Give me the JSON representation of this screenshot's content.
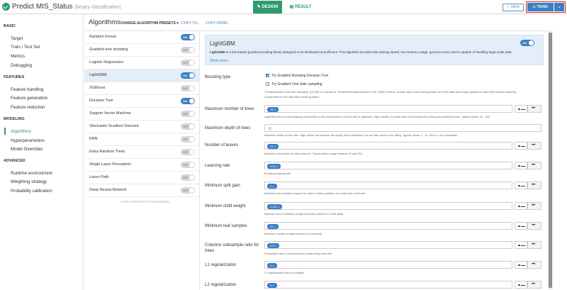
{
  "header": {
    "title": "Predict MIS_Status",
    "subtitle": "(binary classification)",
    "tab_design": "DESIGN",
    "tab_result": "RESULT",
    "save_label": "SAVE",
    "train_label": "TRAIN"
  },
  "sidebar": {
    "sections": [
      {
        "title": "BASIC",
        "items": [
          "Target",
          "Train / Test Set",
          "Metrics",
          "Debugging"
        ]
      },
      {
        "title": "FEATURES",
        "items": [
          "Feature handling",
          "Feature generation",
          "Feature reduction"
        ]
      },
      {
        "title": "MODELING",
        "items": [
          "Algorithms",
          "Hyperparameters",
          "Model Overrides"
        ]
      },
      {
        "title": "ADVANCED",
        "items": [
          "Runtime environment",
          "Weighting strategy",
          "Probability calibration"
        ]
      }
    ],
    "active": "Algorithms"
  },
  "algorithms_panel": {
    "title": "Algorithms",
    "presets_label": "CHANGE ALGORITHM PRESETS",
    "copy_to": "COPY TO...",
    "copy_from": "COPY FROM...",
    "add_custom": "ADD CUSTOM PYTHON MODEL"
  },
  "algorithms": [
    {
      "name": "Random Forest",
      "state": "ON"
    },
    {
      "name": "Gradient tree boosting",
      "state": "OFF"
    },
    {
      "name": "Logistic Regression",
      "state": "OFF"
    },
    {
      "name": "LightGBM",
      "state": "ON"
    },
    {
      "name": "XGBoost",
      "state": "OFF"
    },
    {
      "name": "Decision Tree",
      "state": "ON"
    },
    {
      "name": "Support Vector Machine",
      "state": "OFF"
    },
    {
      "name": "Stochastic Gradient Descent",
      "state": "OFF"
    },
    {
      "name": "KNN",
      "state": "OFF"
    },
    {
      "name": "Extra Random Trees",
      "state": "OFF"
    },
    {
      "name": "Single Layer Perceptron",
      "state": "OFF"
    },
    {
      "name": "Lasso Path",
      "state": "OFF"
    },
    {
      "name": "Deep Neural Network",
      "state": "OFF"
    }
  ],
  "selected_algorithm": "LightGBM",
  "detail": {
    "title": "LightGBM",
    "toggle": "ON",
    "desc_bold": "LightGBM",
    "desc_rest": " is a tree-based gradient boosting library designed to be distributed and efficient. This algorithm provides fast training speed, low memory usage, good accuracy and is capable of handling large scale data.",
    "show_more": "Show more...",
    "boosting_type": {
      "label": "Boosting type",
      "options": [
        {
          "label": "Try Gradient Boosting Decision Tree",
          "checked": true
        },
        {
          "label": "Try Gradient One-Side sampling",
          "checked": false
        }
      ],
      "help1": "\"Gradient-based One-Side Sampling\" (GOSS) is a variant of \"Gradient Boosting Decision Tree\" (GBDT) where, at each step of the training phase, all of the data with a large gradient is kept while random sampling",
      "help2": "is performed on the data with a small gradient."
    },
    "params": [
      {
        "label": "Maximum number of trees",
        "value": "75",
        "chip": true,
        "help": "LightGBM has an early stopping mechanism so the exact number of trees will be optimized. High number of actual trees will increase the training and prediction time. Typical values: 30 - 300",
        "mini": true
      },
      {
        "label": "Maximum depth of trees",
        "value": "-1",
        "chip": false,
        "help": "Maximum depth of each tree. High values can increase the quality of the prediction, but can also lead to over-fitting. Typical values: 3 - 10. Set to -1 to unconstrain.",
        "mini": false
      },
      {
        "label": "Number of leaves",
        "value": "31",
        "chip": true,
        "help": "Maximum tree leaves for base learners. Typical values range between 20 and 300",
        "mini": true
      },
      {
        "label": "Learning rate",
        "value": "0.02",
        "chip": true,
        "help": "Boosting learning rate",
        "mini": true
      },
      {
        "label": "Minimum split gain",
        "value": "0",
        "chip": true,
        "help": "Minimum loss reduction required to make a further partition on a leaf node of the tree",
        "mini": true
      },
      {
        "label": "Minimum child weight",
        "value": "0.001",
        "chip": true,
        "help": "Minimum sum of instance weight (hessian) needed in a child (leaf)",
        "mini": true
      },
      {
        "label": "Minimum leaf samples",
        "value": "20",
        "chip": true,
        "help": "Minimum number of data needed in a child (leaf)",
        "mini": true
      },
      {
        "label": "Columns subsample ratio for trees",
        "value": "0.9",
        "chip": true,
        "help": "Subsample ratio of columns when constructing each tree",
        "mini": true
      },
      {
        "label": "L1 regularization",
        "value": "0",
        "chip": true,
        "help": "L1 regularization term on weights",
        "mini": true
      },
      {
        "label": "L2 regularization",
        "value": "0",
        "chip": true,
        "help": "",
        "mini": true
      }
    ]
  },
  "colors": {
    "accent_green": "#2d9b6f",
    "accent_blue": "#3c7ec2",
    "highlight_red": "#e32020"
  }
}
